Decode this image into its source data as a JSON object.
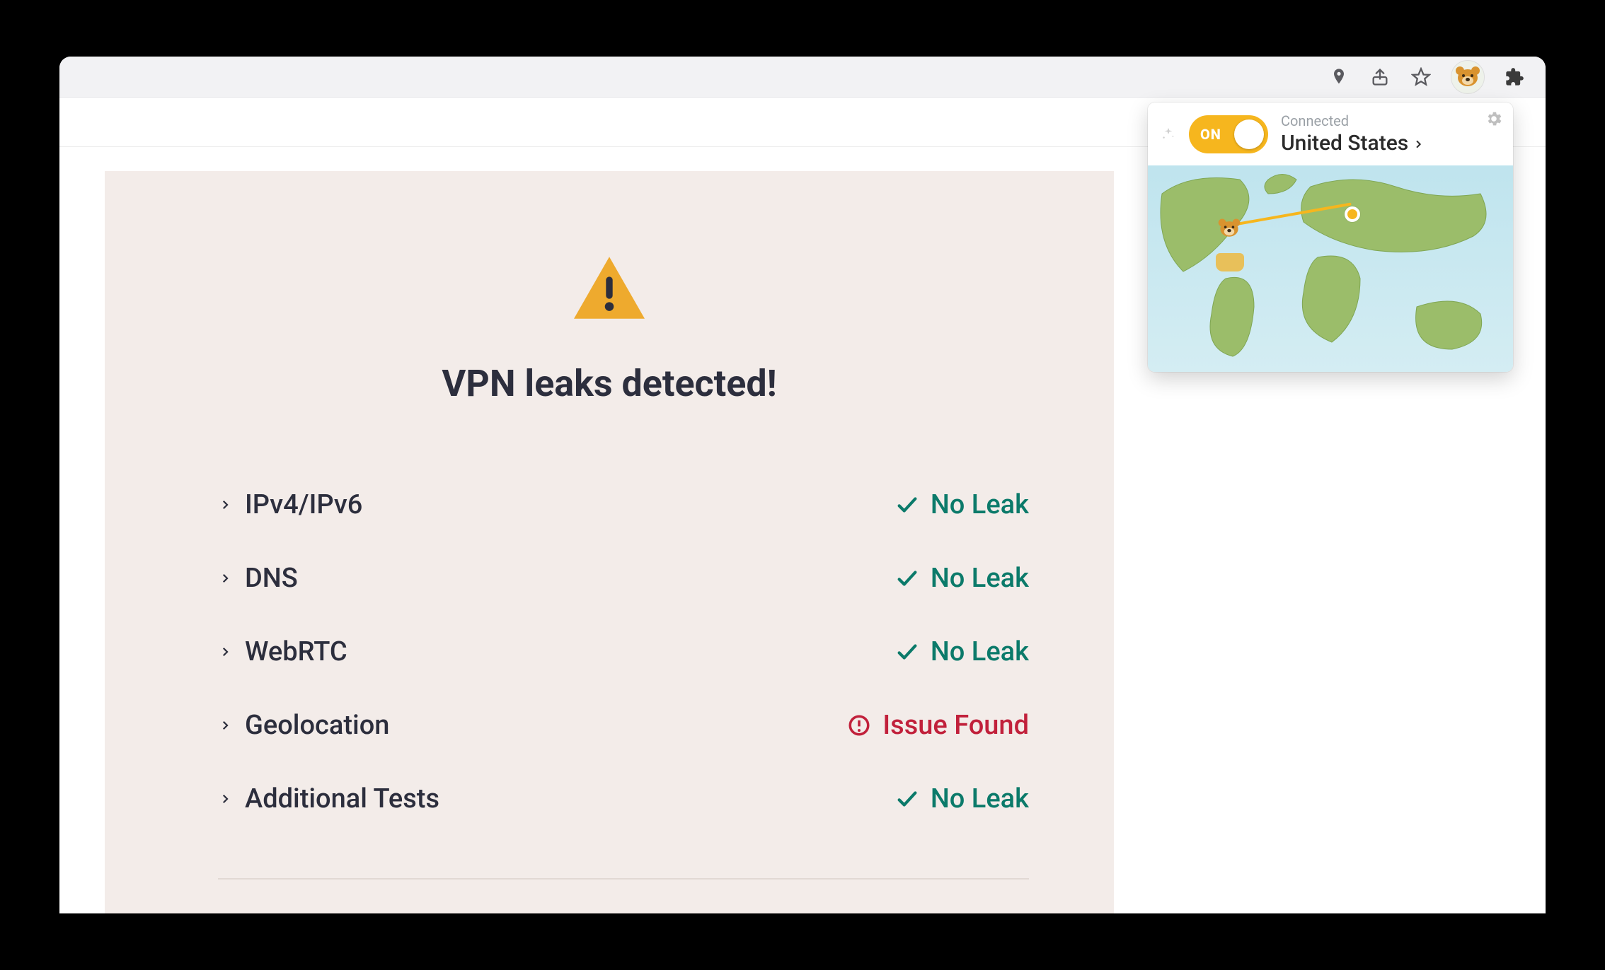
{
  "browser": {
    "icons": {
      "location": "location-pin-icon",
      "share": "share-icon",
      "star": "star-icon",
      "extension": "vpn-extension-icon",
      "extensions_menu": "puzzle-icon"
    }
  },
  "page": {
    "title": "VPN leaks detected!",
    "warning_icon": "warning-triangle-icon",
    "tests": [
      {
        "name": "IPv4/IPv6",
        "status": "ok",
        "status_label": "No Leak"
      },
      {
        "name": "DNS",
        "status": "ok",
        "status_label": "No Leak"
      },
      {
        "name": "WebRTC",
        "status": "ok",
        "status_label": "No Leak"
      },
      {
        "name": "Geolocation",
        "status": "bad",
        "status_label": "Issue Found"
      },
      {
        "name": "Additional Tests",
        "status": "ok",
        "status_label": "No Leak"
      }
    ]
  },
  "extension_popup": {
    "toggle_label": "ON",
    "status_label": "Connected",
    "country": "United States",
    "settings_icon": "gear-icon",
    "map_icon": "world-map"
  },
  "colors": {
    "accent_orange": "#eeaa2e",
    "toggle_yellow": "#f6b61e",
    "ok_green": "#0b7a6a",
    "bad_red": "#c1203b",
    "panel_bg": "#f3ece9",
    "title_text": "#2c2e3d"
  }
}
